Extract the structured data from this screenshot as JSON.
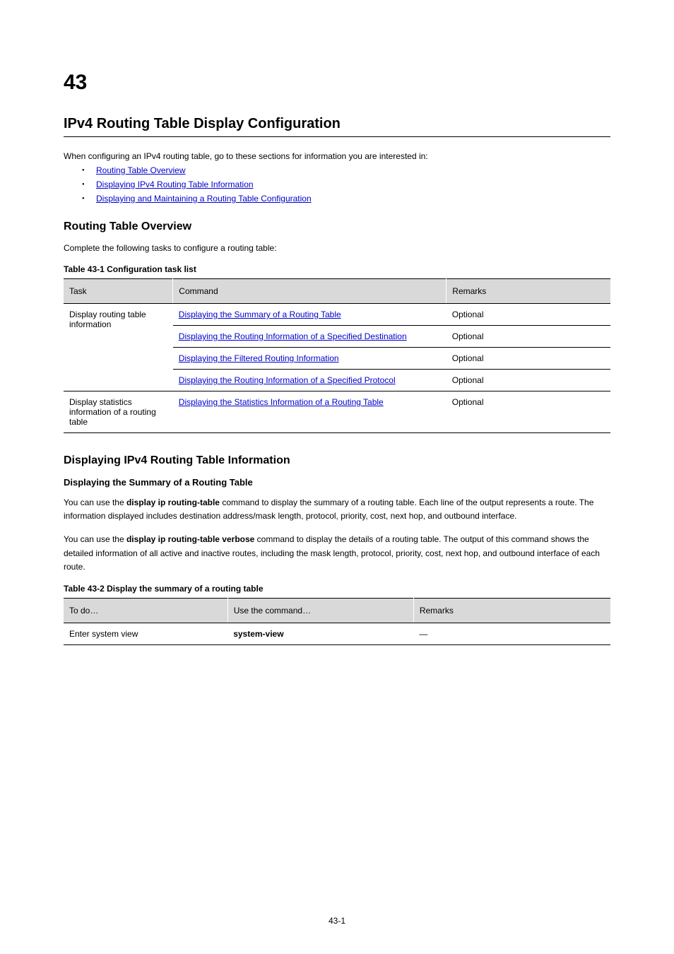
{
  "chapter": {
    "number": "43",
    "title": "IPv4 Routing Table Display Configuration"
  },
  "intro": "When configuring an IPv4 routing table, go to these sections for information you are interested in:",
  "bullets": [
    {
      "text": "Routing Table Overview"
    },
    {
      "text": "Displaying IPv4 Routing Table Information"
    },
    {
      "text": "Displaying and Maintaining a Routing Table Configuration"
    }
  ],
  "section1": {
    "title": "Routing Table Overview",
    "intro": "Complete the following tasks to configure a routing table:"
  },
  "table1": {
    "caption": "Table 43-1 Configuration task list",
    "headers": [
      "Task",
      "Command",
      "Remarks"
    ],
    "rows": [
      {
        "task": "Display routing table information",
        "cmd_link": "Displaying the Summary of a Routing Table",
        "remarks": "Optional"
      },
      {
        "task": "",
        "cmd_link": "Displaying the Routing Information of a Specified Destination",
        "remarks": "Optional"
      },
      {
        "task": "",
        "cmd_prefix": "Displaying the ",
        "cmd_link_a": "Filtered Routing Information",
        "cmd_mid": "",
        "cmd_link_b": "",
        "remarks": "Optional"
      },
      {
        "task": "",
        "cmd_prefix": "Displaying the ",
        "cmd_link_a": "Routing Information of a Specified Protocol",
        "cmd_mid": "",
        "cmd_link_b": "",
        "remarks": "Optional"
      },
      {
        "task": "Display statistics information of a routing table",
        "cmd_link": "Displaying the Statistics Information of a Routing Table",
        "remarks": "Optional"
      }
    ]
  },
  "section2": {
    "title": "Displaying IPv4 Routing Table Information",
    "sub1": {
      "heading": "Displaying the Summary of a Routing Table",
      "p1_prefix": "You can use the ",
      "p1_cmd": "display ip routing-table",
      "p1_suffix": " command to display the summary of a routing table. Each line of the output represents a route. The information displayed includes destination address/mask length, protocol, priority, cost, next hop, and outbound interface.",
      "p2_prefix": "You can use the ",
      "p2_cmd": "display ip routing-table verbose",
      "p2_suffix": " command to display the details of a routing table. The output of this command shows the detailed information of all active and inactive routes, including the mask length, protocol, priority, cost, next hop, and outbound interface of each route."
    }
  },
  "table2": {
    "caption": "Table 43-2 Display the summary of a routing table",
    "headers": [
      "To do…",
      "Use the command…",
      "Remarks"
    ],
    "rows": [
      {
        "to": "Enter system view",
        "use": "system-view",
        "remarks": "—"
      }
    ]
  },
  "pageNumber": "43-1"
}
